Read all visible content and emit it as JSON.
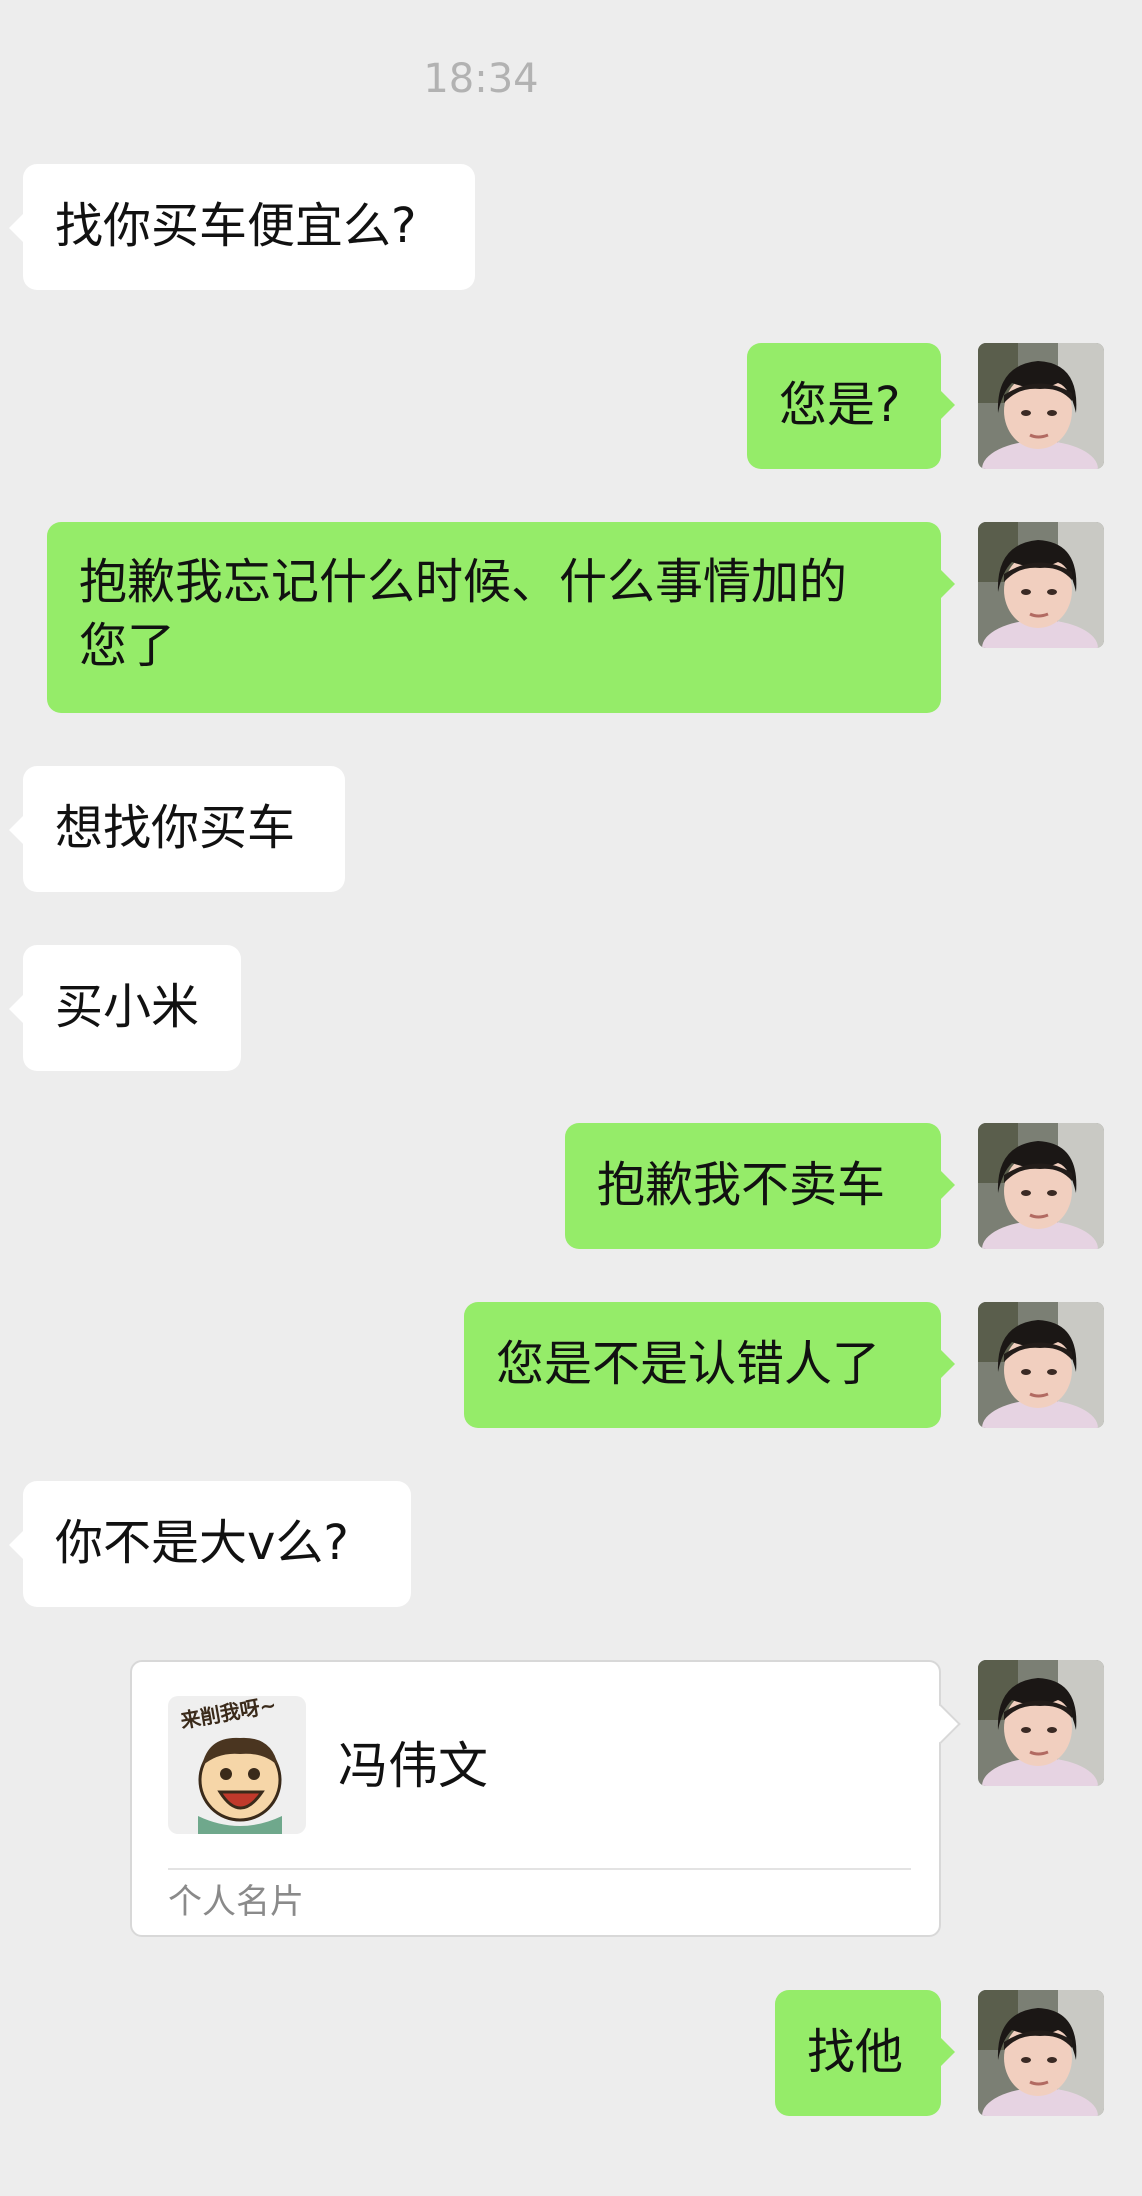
{
  "chat": {
    "timestamp": "18:34",
    "messages": [
      {
        "side": "in",
        "text": "找你买车便宜么?"
      },
      {
        "side": "out",
        "text": "您是?"
      },
      {
        "side": "out",
        "text": "抱歉我忘记什么时候、什么事情加的\n您了"
      },
      {
        "side": "in",
        "text": "想找你买车"
      },
      {
        "side": "in",
        "text": "买小米"
      },
      {
        "side": "out",
        "text": "抱歉我不卖车"
      },
      {
        "side": "out",
        "text": "您是不是认错人了"
      },
      {
        "side": "in",
        "text": "你不是大v么?"
      },
      {
        "side": "out",
        "text": "找他"
      }
    ],
    "contact_card": {
      "name": "冯伟文",
      "label": "个人名片",
      "sticker_text": "来削我呀~"
    }
  },
  "colors": {
    "background": "#ededed",
    "incoming_bubble": "#ffffff",
    "outgoing_bubble": "#95ec69",
    "timestamp": "#b2b2b2"
  }
}
